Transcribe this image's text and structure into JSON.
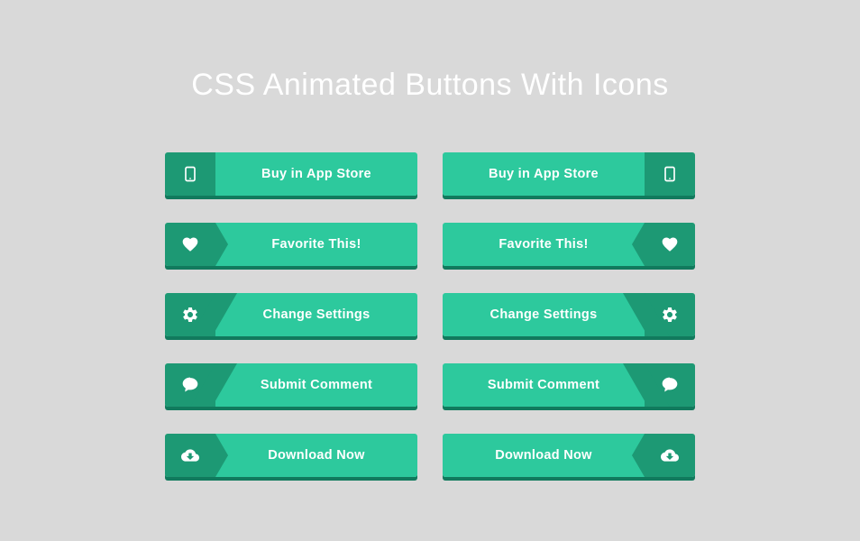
{
  "title": "CSS Animated Buttons With Icons",
  "buttons": {
    "appstore": "Buy in App Store",
    "favorite": "Favorite This!",
    "settings": "Change Settings",
    "comment": "Submit Comment",
    "download": "Download Now"
  }
}
